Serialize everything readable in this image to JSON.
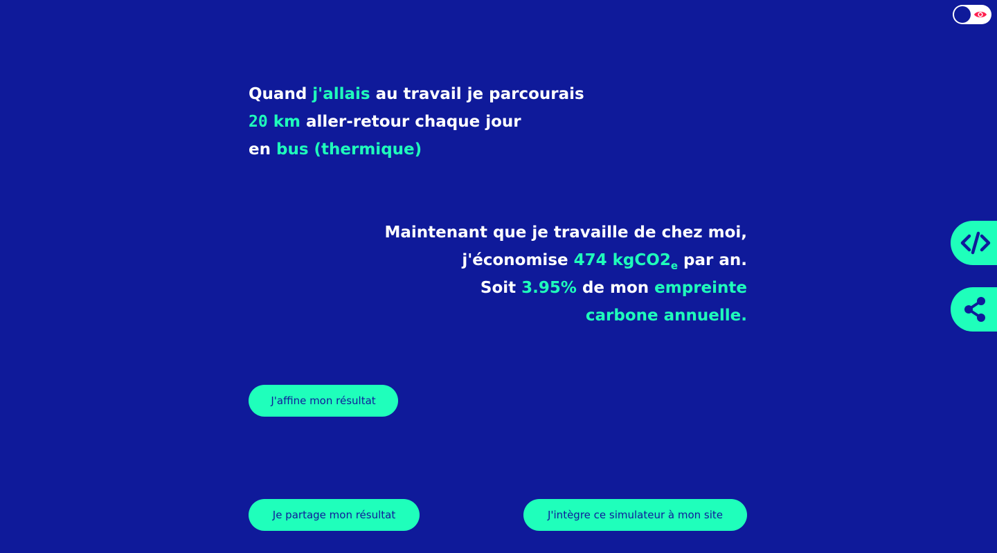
{
  "toggle": {
    "icon": "eye-icon"
  },
  "intro": {
    "l1_a": "Quand ",
    "l1_b": "j'allais",
    "l1_c": " au travail je parcourais",
    "l2_num": "20",
    "l2_unit": " km",
    "l2_c": " aller-retour chaque jour",
    "l3_a": "en ",
    "l3_b": "bus (thermique)"
  },
  "result": {
    "l1": "Maintenant que je travaille de chez moi,",
    "l2_a": "j'économise ",
    "l2_value": "474 kgCO2",
    "l2_sub": "e",
    "l2_c": " par an.",
    "l3_a": "Soit ",
    "l3_pct": "3.95%",
    "l3_c": " de mon ",
    "l3_d": "empreinte",
    "l4": "carbone annuelle."
  },
  "buttons": {
    "affine": "J'affine mon résultat",
    "share": "Je partage mon résultat",
    "embed": "J'intègre ce simulateur à mon site"
  },
  "side_tabs": {
    "embed_icon": "code-icon",
    "share_icon": "share-icon"
  },
  "colors": {
    "background": "#0f1a9a",
    "accent": "#1fffbb",
    "text": "#ffffff",
    "eye": "#ff1f4f"
  }
}
